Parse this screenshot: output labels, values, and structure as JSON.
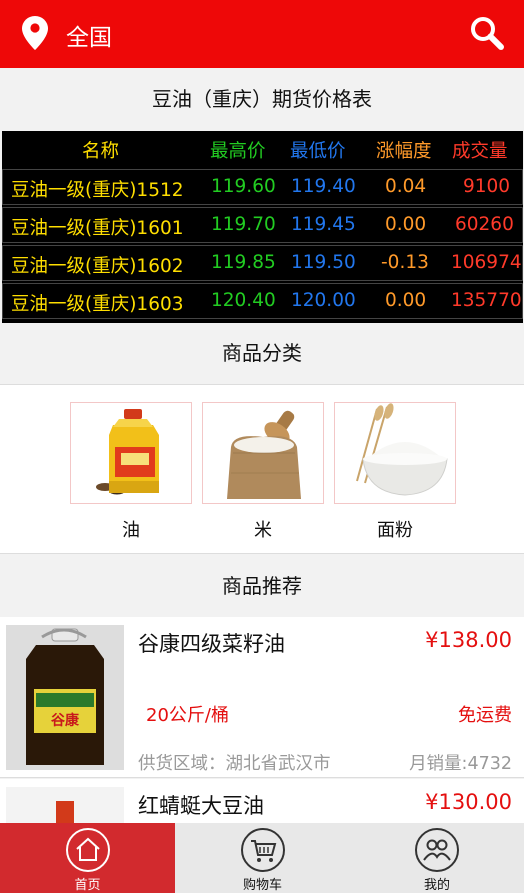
{
  "header": {
    "location": "全国",
    "location_icon": "location-pin-icon",
    "search_icon": "search-icon",
    "bg_color": "#ee0808"
  },
  "price_table": {
    "title": "豆油（重庆）期货价格表",
    "columns": [
      "名称",
      "最高价",
      "最低价",
      "涨幅度",
      "成交量"
    ],
    "rows": [
      [
        "豆油一级(重庆)1512",
        "119.60",
        "119.40",
        "0.04",
        "9100"
      ],
      [
        "豆油一级(重庆)1601",
        "119.70",
        "119.45",
        "0.00",
        "60260"
      ],
      [
        "豆油一级(重庆)1602",
        "119.85",
        "119.50",
        "-0.13",
        "106974"
      ],
      [
        "豆油一级(重庆)1603",
        "120.40",
        "120.00",
        "0.00",
        "135770"
      ]
    ]
  },
  "categories": {
    "title": "商品分类",
    "items": [
      {
        "label": "油",
        "icon": "oil-bottle-icon"
      },
      {
        "label": "米",
        "icon": "rice-sack-icon"
      },
      {
        "label": "面粉",
        "icon": "flour-bowl-icon"
      }
    ]
  },
  "recommend": {
    "title": "商品推荐",
    "products": [
      {
        "name": "谷康四级菜籽油",
        "price": "¥138.00",
        "spec": "20公斤/桶",
        "shipping": "免运费",
        "region": "供货区域：湖北省武汉市",
        "sales": "月销量:4732",
        "label_text": "谷康"
      },
      {
        "name": "红蜻蜓大豆油",
        "price": "¥130.00"
      }
    ]
  },
  "tabbar": {
    "items": [
      {
        "label": "首页",
        "icon": "home-icon",
        "active": true
      },
      {
        "label": "购物车",
        "icon": "cart-icon",
        "active": false
      },
      {
        "label": "我的",
        "icon": "user-profile-icon",
        "active": false
      }
    ]
  },
  "colors": {
    "accent": "#ee0808",
    "tab_active": "#d22a2e",
    "price_red": "#e40f0f",
    "high_green": "#22cc22",
    "low_blue": "#2277ee",
    "change_orange": "#ff9a2a",
    "name_yellow": "#ffde00"
  }
}
